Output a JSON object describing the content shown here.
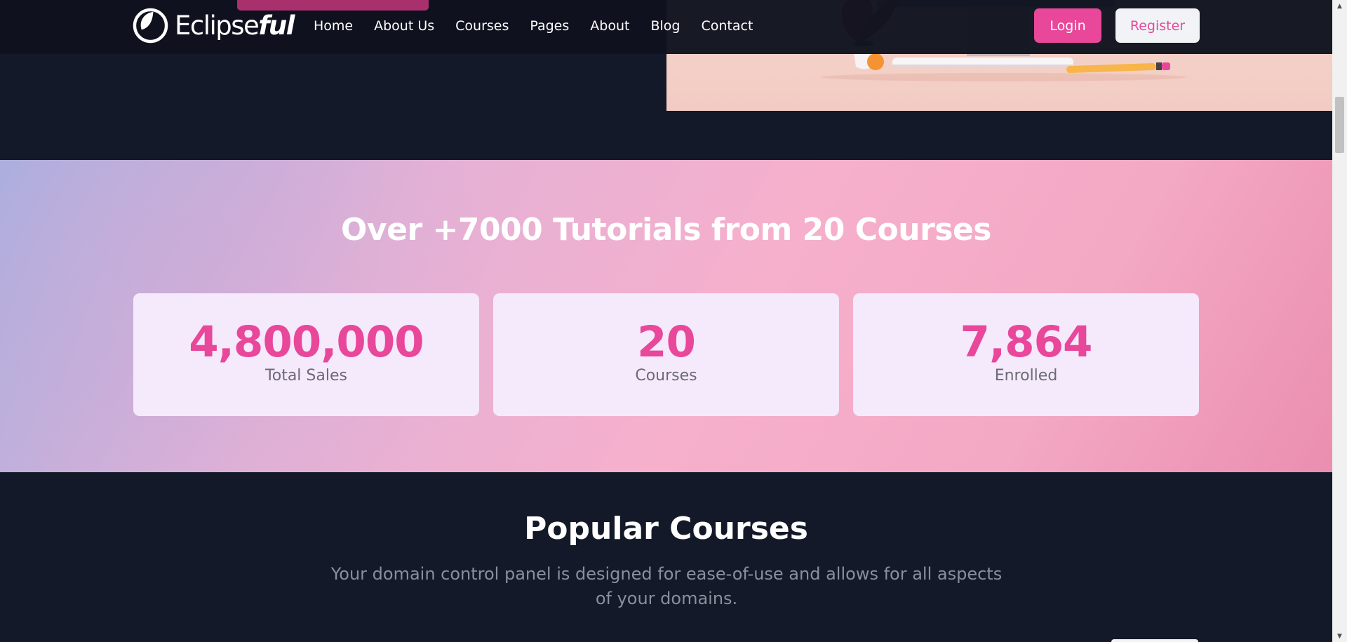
{
  "brand": {
    "name_prefix": "Eclipse",
    "name_suffix": "ful"
  },
  "nav": {
    "items": [
      "Home",
      "About Us",
      "Courses",
      "Pages",
      "About",
      "Blog",
      "Contact"
    ]
  },
  "auth": {
    "login_label": "Login",
    "register_label": "Register"
  },
  "stats": {
    "title": "Over +7000 Tutorials from 20 Courses",
    "cards": [
      {
        "value": "4,800,000",
        "label": "Total Sales"
      },
      {
        "value": "20",
        "label": "Courses"
      },
      {
        "value": "7,864",
        "label": "Enrolled"
      }
    ]
  },
  "popular": {
    "title": "Popular Courses",
    "subtitle": "Your domain control panel is designed for ease-of-use and allows for all aspects of your domains."
  },
  "colors": {
    "accent": "#e8479a",
    "page_background": "#131929",
    "card_background": "#f5e9fc"
  },
  "icons": {
    "logo": "eclipse-logo-icon",
    "scroll_up": "scroll-up-arrow-icon",
    "scroll_down": "scroll-down-arrow-icon"
  }
}
